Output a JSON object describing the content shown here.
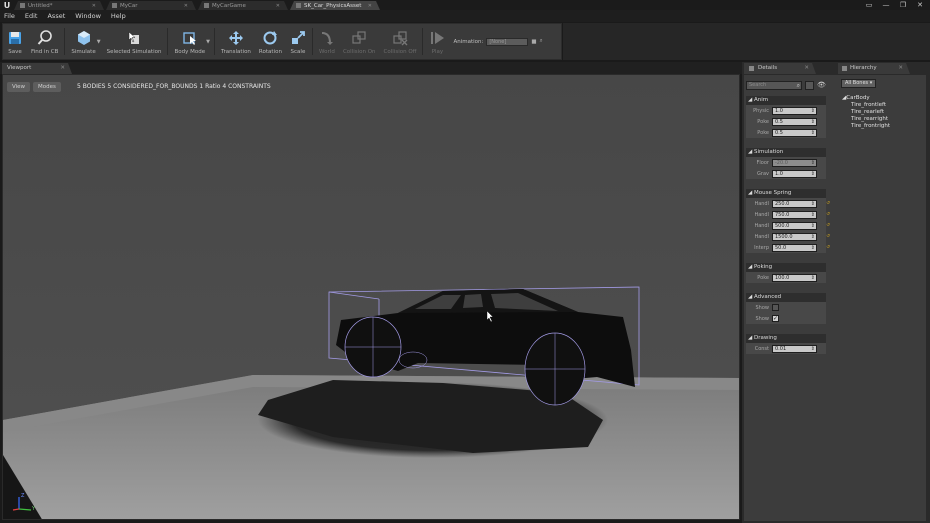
{
  "titlebar": {
    "logo": "U",
    "tabs": [
      {
        "label": "Untitled*",
        "active": false
      },
      {
        "label": "MyCar",
        "active": false
      },
      {
        "label": "MyCarGame",
        "active": false
      },
      {
        "label": "SK_Car_PhysicsAsset",
        "active": true
      }
    ],
    "window_controls": [
      "▭",
      "—",
      "❐",
      "✕"
    ]
  },
  "menu": [
    "File",
    "Edit",
    "Asset",
    "Window",
    "Help"
  ],
  "toolbar": {
    "save": "Save",
    "find_in_cb": "Find in CB",
    "simulate": "Simulate",
    "selected_simulation": "Selected Simulation",
    "body_mode": "Body Mode",
    "translation": "Translation",
    "rotation": "Rotation",
    "scale": "Scale",
    "world": "World",
    "collision_on": "Collision On",
    "collision_off": "Collision Off",
    "play": "Play",
    "animation_label": "Animation:",
    "animation_value": "[None]"
  },
  "viewport": {
    "tab_label": "Viewport",
    "view_button": "View",
    "modes_button": "Modes",
    "stats": "5 BODIES  5 CONSIDERED_FOR_BOUNDS  1 Ratio  4 CONSTRAINTS",
    "gizmo_z": "Z",
    "gizmo_y": "Y",
    "colors": {
      "background": "#4a4a4a",
      "floor": "#8e8e8e",
      "bounds": "#9a92e0"
    }
  },
  "details": {
    "tab_label": "Details",
    "search_placeholder": "Search",
    "categories": {
      "anim": {
        "title": "Anim",
        "rows": [
          {
            "label": "Physic",
            "value": "1.0"
          },
          {
            "label": "Poke",
            "value": "0.5"
          },
          {
            "label": "Poke",
            "value": "0.5"
          }
        ]
      },
      "simulation": {
        "title": "Simulation",
        "rows": [
          {
            "label": "Floor",
            "value": "-20.0"
          },
          {
            "label": "Grav",
            "value": "1.0"
          }
        ]
      },
      "mouse_spring": {
        "title": "Mouse Spring",
        "rows": [
          {
            "label": "Handl",
            "value": "250.0"
          },
          {
            "label": "Handl",
            "value": "750.0"
          },
          {
            "label": "Handl",
            "value": "500.0"
          },
          {
            "label": "Handl",
            "value": "1500.0"
          },
          {
            "label": "Interp",
            "value": "50.0"
          }
        ]
      },
      "poking": {
        "title": "Poking",
        "rows": [
          {
            "label": "Poke",
            "value": "100.0"
          }
        ]
      },
      "advanced": {
        "title": "Advanced",
        "rows": [
          {
            "label": "Show",
            "checked": false
          },
          {
            "label": "Show",
            "checked": true
          }
        ]
      },
      "drawing": {
        "title": "Drawing",
        "rows": [
          {
            "label": "Const",
            "value": "0.01"
          }
        ]
      }
    }
  },
  "hierarchy": {
    "tab_label": "Hierarchy",
    "filter": "All Bones",
    "root": "CarBody",
    "children": [
      "Tire_frontleft",
      "Tire_rearleft",
      "Tire_rearright",
      "Tire_frontright"
    ]
  }
}
